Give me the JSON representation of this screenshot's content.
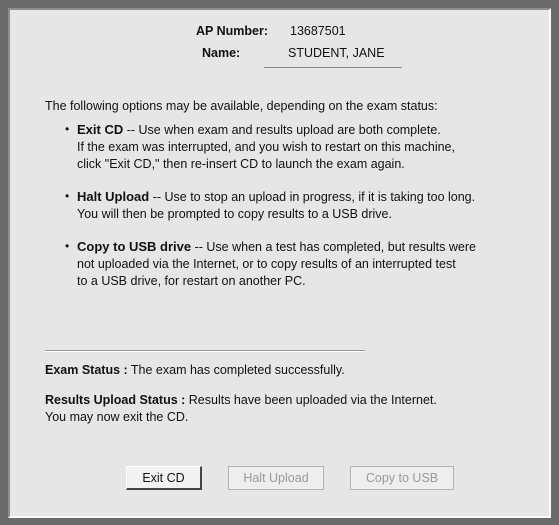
{
  "identity": {
    "ap_number_label": "AP Number:",
    "ap_number_value": "13687501",
    "name_label": "Name:",
    "name_value": "STUDENT, JANE"
  },
  "intro": "The following options may be available, depending on the exam status:",
  "options": [
    {
      "bullet": "•",
      "title": "Exit CD",
      "lines": [
        " -- Use when exam and results upload are both complete.",
        "If the exam was interrupted, and you wish to restart on this machine,",
        "click \"Exit CD,\" then re-insert CD to launch the exam again."
      ]
    },
    {
      "bullet": "•",
      "title": "Halt Upload",
      "lines": [
        " -- Use to stop an upload in progress, if it is taking too long.",
        "You will then be prompted to copy results to a USB drive."
      ]
    },
    {
      "bullet": "•",
      "title": "Copy to USB drive",
      "lines": [
        " -- Use when a test has completed, but results were",
        "not uploaded via the Internet, or to copy results of an interrupted test",
        "to a USB drive, for restart on another PC."
      ]
    }
  ],
  "status": {
    "exam_label": "Exam Status :",
    "exam_text": " The exam has completed successfully.",
    "upload_label": "Results Upload Status :",
    "upload_text": " Results have been uploaded via the Internet.",
    "upload_text_2": "You may now exit the CD."
  },
  "buttons": {
    "exit_cd": "Exit CD",
    "halt_upload": "Halt Upload",
    "copy_to_usb": "Copy to USB"
  }
}
